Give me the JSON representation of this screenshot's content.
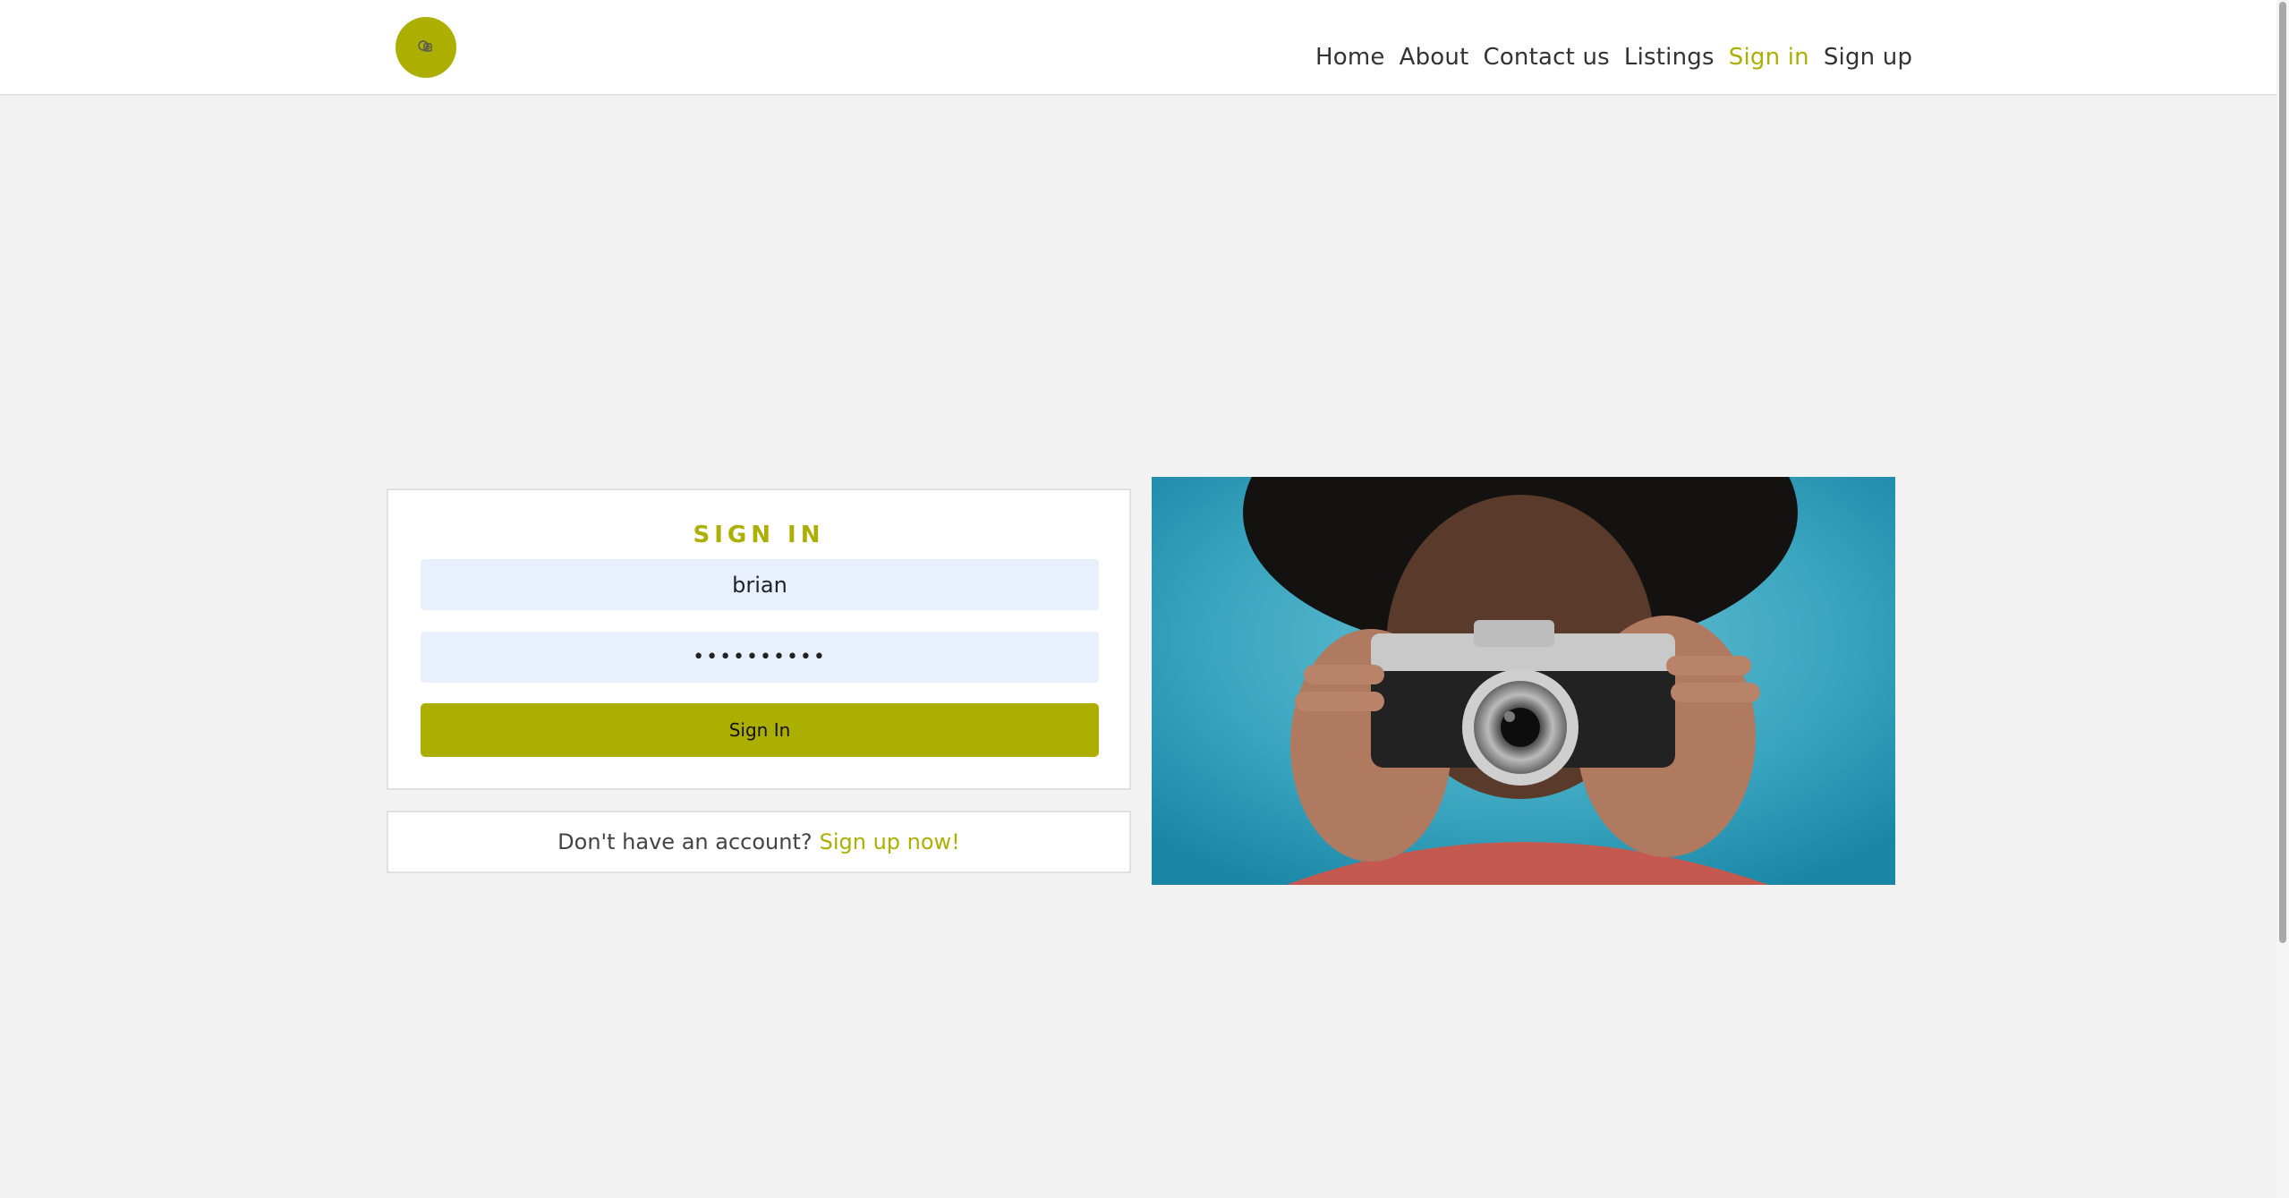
{
  "header": {
    "logo_icon": "camera-logo-icon",
    "nav": [
      {
        "label": "Home",
        "active": false
      },
      {
        "label": "About",
        "active": false
      },
      {
        "label": "Contact us",
        "active": false
      },
      {
        "label": "Listings",
        "active": false
      },
      {
        "label": "Sign in",
        "active": true
      },
      {
        "label": "Sign up",
        "active": false
      }
    ]
  },
  "signin": {
    "title": "SIGN IN",
    "username_value": "brian",
    "password_value": "••••••••••",
    "button_label": "Sign In"
  },
  "signup_prompt": {
    "text": "Don't have an account?",
    "link": "Sign up now!"
  },
  "colors": {
    "accent": "#adaf00",
    "background": "#f2f2f2",
    "input_bg": "#e8f0fe"
  }
}
